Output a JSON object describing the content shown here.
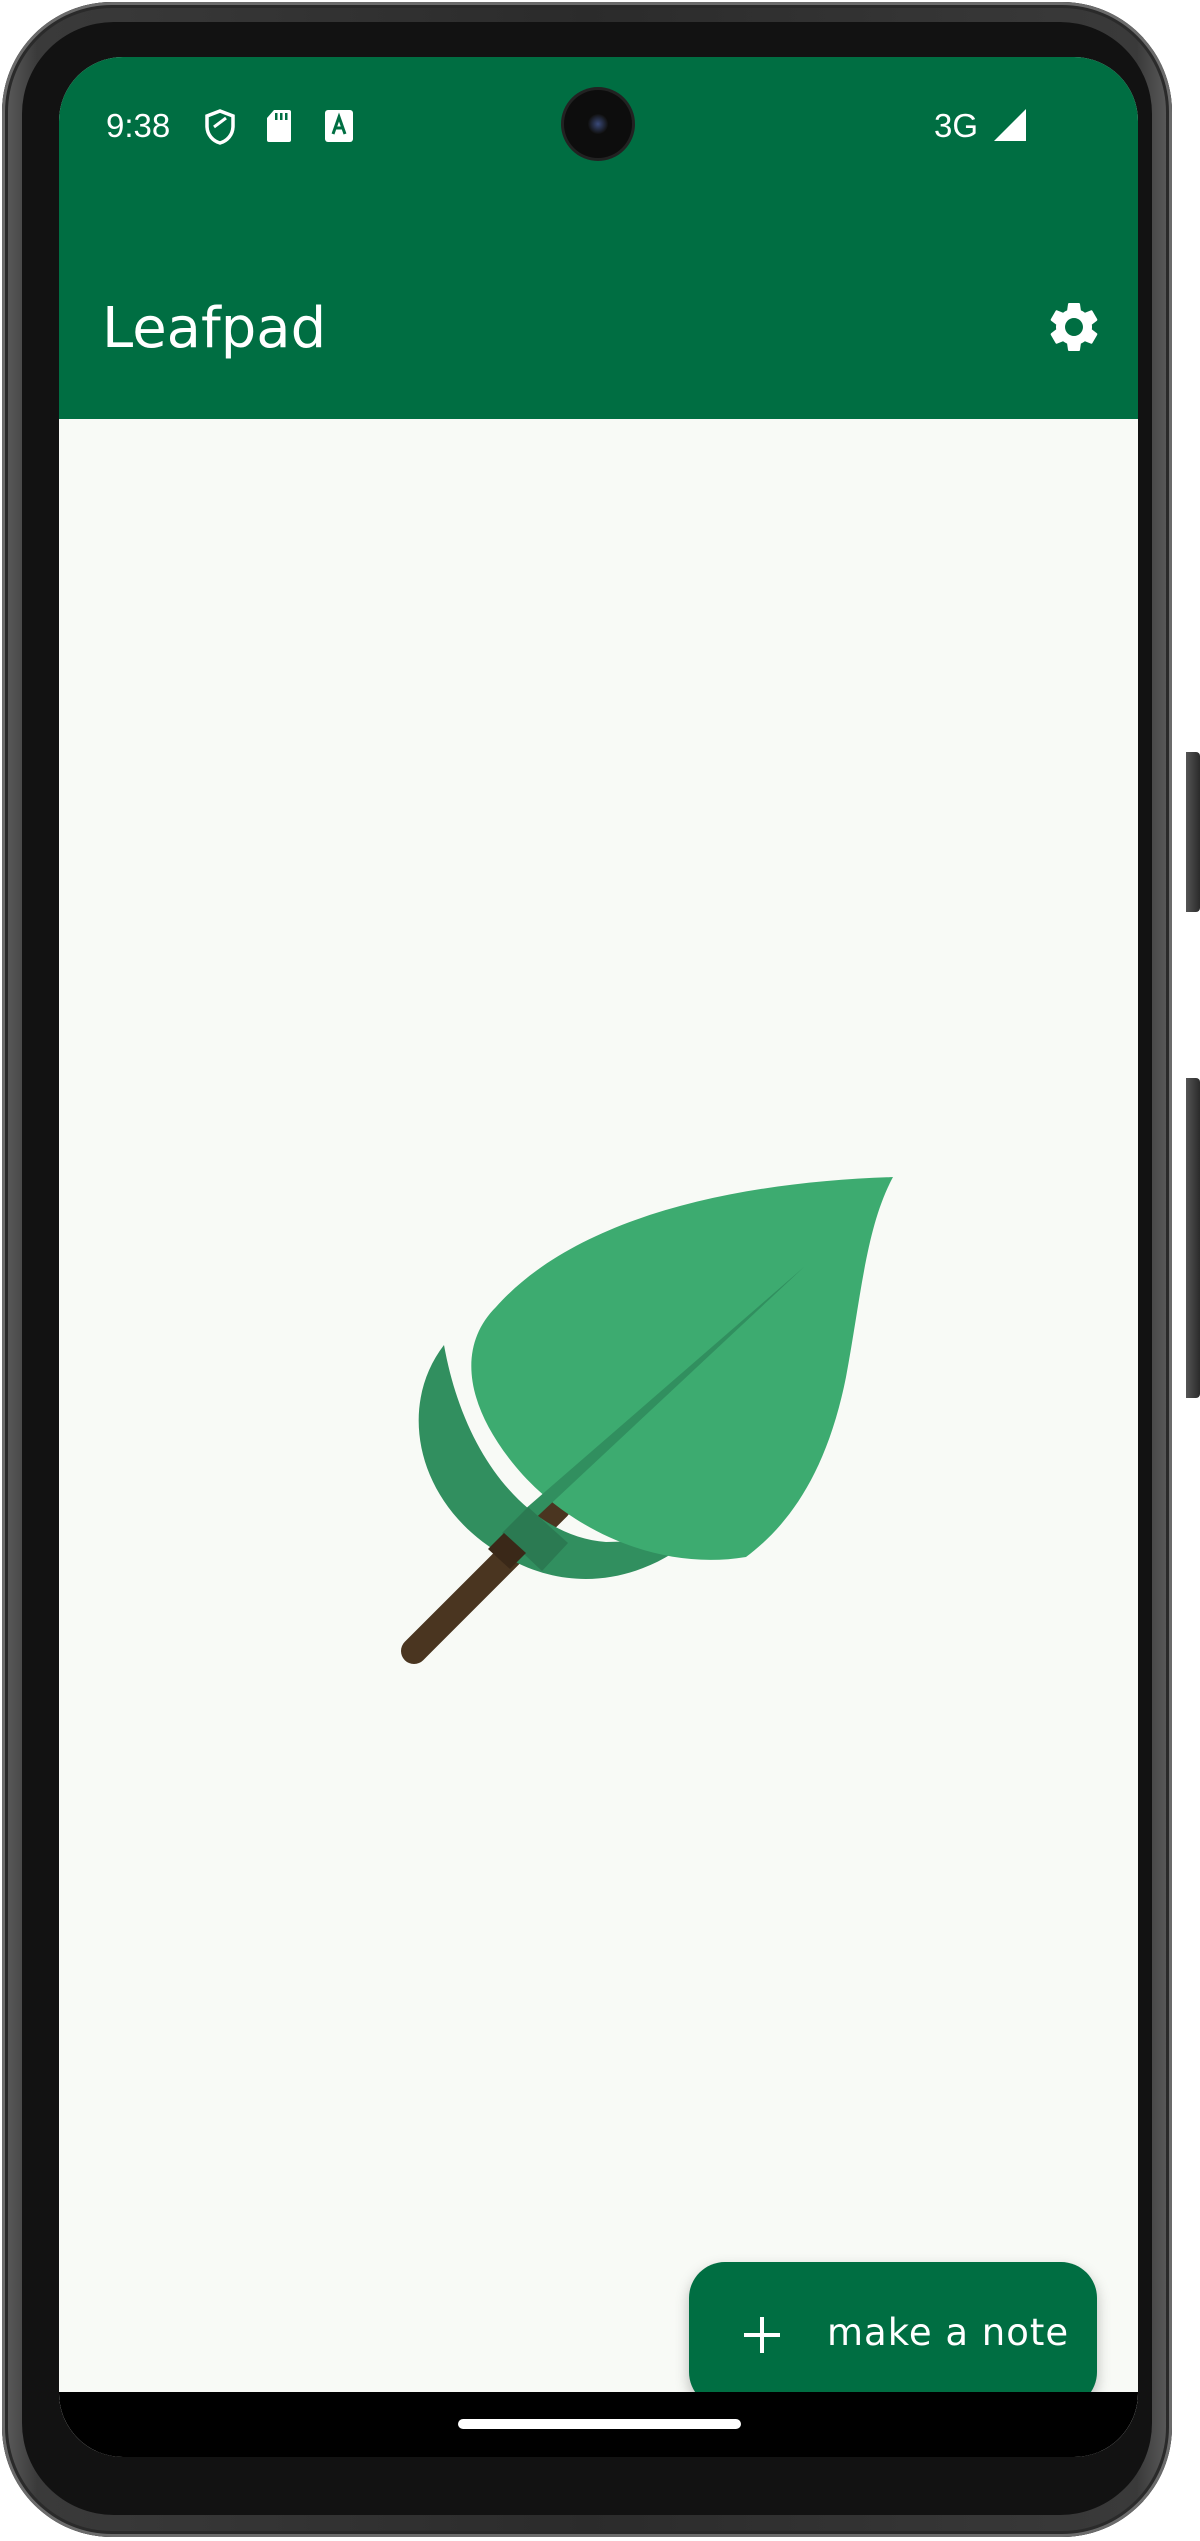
{
  "status_bar": {
    "time": "9:38",
    "icons": [
      "shield-icon",
      "sd-card-icon",
      "text-a-icon"
    ],
    "network": "3G",
    "signal_icon": "signal-icon"
  },
  "app_bar": {
    "title": "Leafpad",
    "settings_icon": "gear-icon"
  },
  "content": {
    "illustration": "leaf-icon"
  },
  "fab": {
    "icon": "plus-icon",
    "label": "make a note"
  },
  "colors": {
    "primary": "#006e42",
    "background": "#f8faf6",
    "leaf_light": "#3dab70",
    "leaf_dark": "#318f5f",
    "stem": "#4a3520"
  }
}
